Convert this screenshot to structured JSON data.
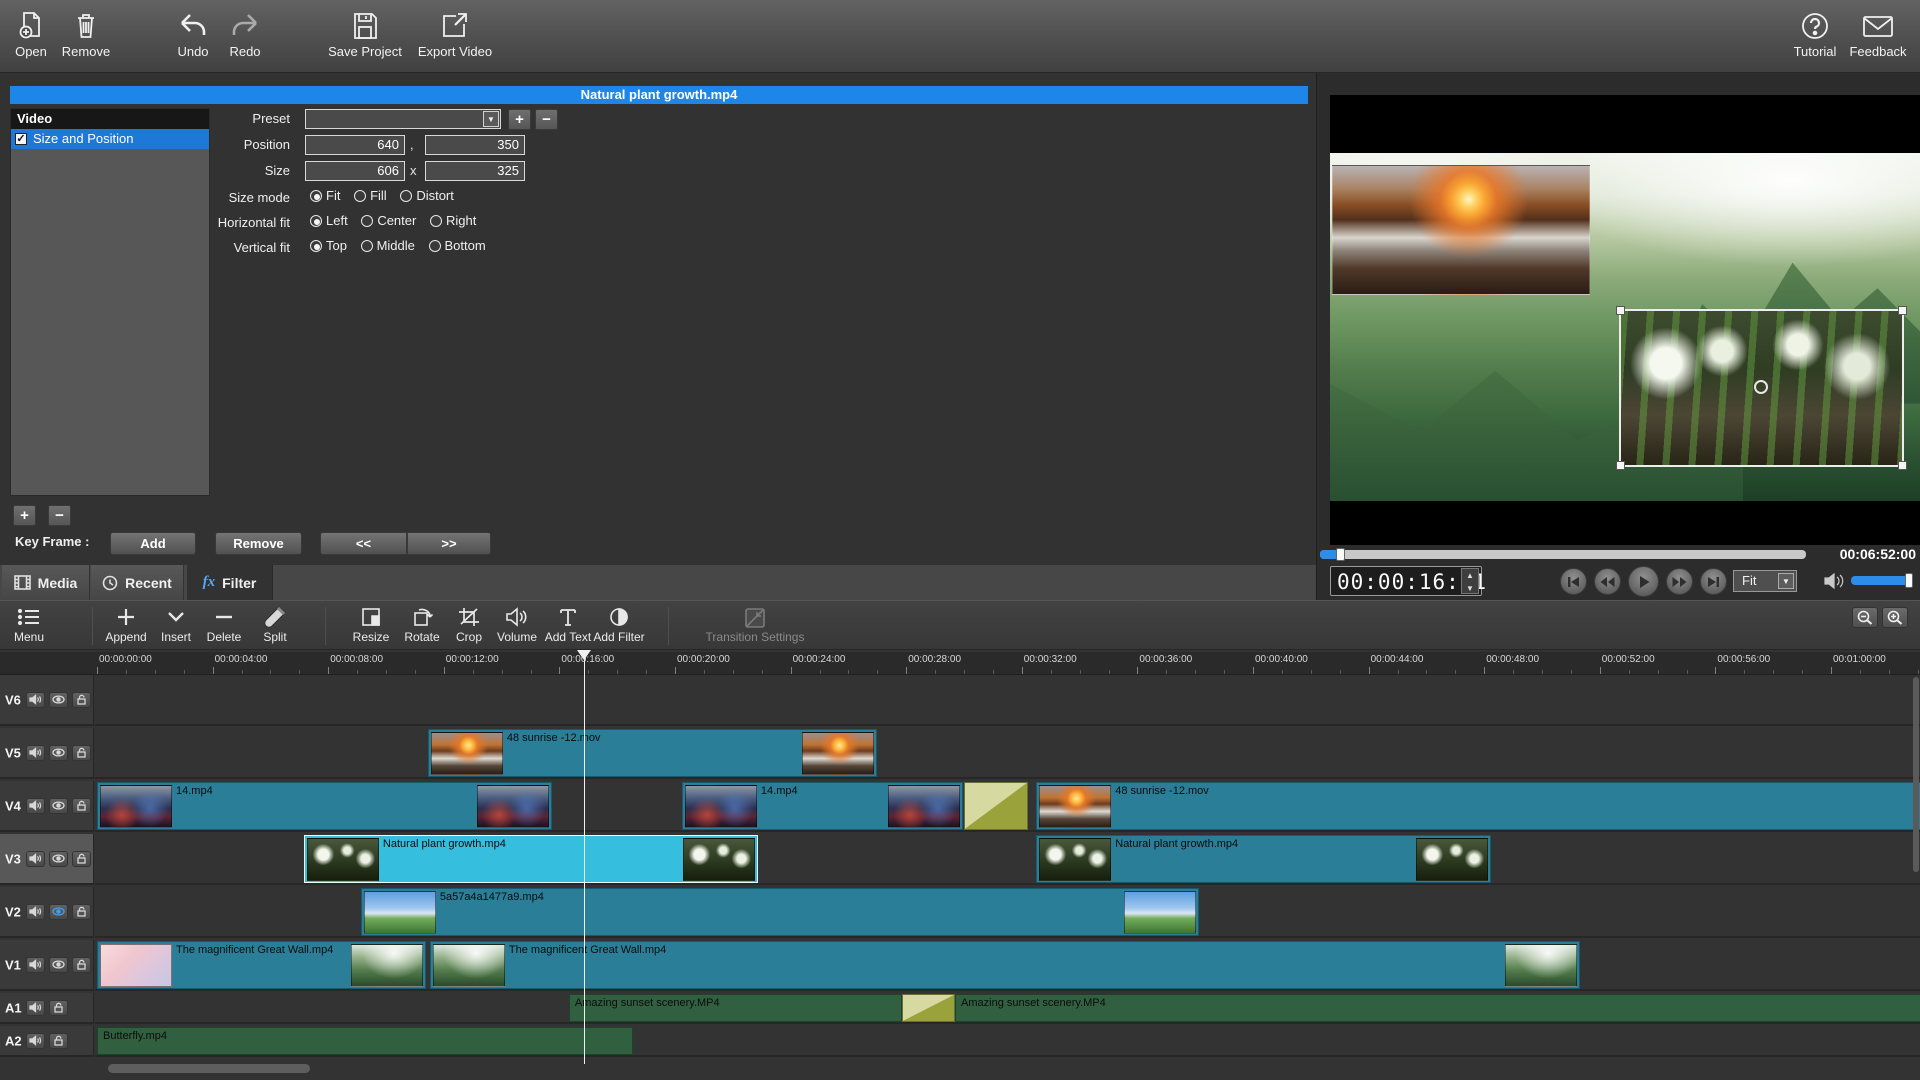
{
  "toolbar": {
    "items": [
      {
        "id": "open",
        "label": "Open"
      },
      {
        "id": "remove",
        "label": "Remove"
      },
      {
        "id": "undo",
        "label": "Undo"
      },
      {
        "id": "redo",
        "label": "Redo"
      },
      {
        "id": "save",
        "label": "Save Project"
      },
      {
        "id": "export",
        "label": "Export Video"
      }
    ],
    "right_items": [
      {
        "id": "tutorial",
        "label": "Tutorial"
      },
      {
        "id": "feedback",
        "label": "Feedback"
      }
    ]
  },
  "properties": {
    "title": "Natural plant growth.mp4",
    "filter_list": {
      "header": "Video",
      "items": [
        {
          "label": "Size and Position",
          "checked": true
        }
      ]
    },
    "preset_label": "Preset",
    "position_label": "Position",
    "position_x": "640",
    "comma": ",",
    "position_y": "350",
    "size_label": "Size",
    "size_w": "606",
    "times": "x",
    "size_h": "325",
    "size_mode": {
      "label": "Size mode",
      "options": [
        "Fit",
        "Fill",
        "Distort"
      ],
      "selected": "Fit"
    },
    "horizontal_fit": {
      "label": "Horizontal fit",
      "options": [
        "Left",
        "Center",
        "Right"
      ],
      "selected": "Left"
    },
    "vertical_fit": {
      "label": "Vertical fit",
      "options": [
        "Top",
        "Middle",
        "Bottom"
      ],
      "selected": "Top"
    },
    "add_filter": "+",
    "remove_filter": "−",
    "keyframe": {
      "label": "Key Frame :",
      "add": "Add",
      "remove": "Remove",
      "prev": "<<",
      "next": ">>"
    }
  },
  "tabs": [
    {
      "label": "Media",
      "active": false
    },
    {
      "label": "Recent",
      "active": false
    },
    {
      "label": "Filter",
      "active": true
    }
  ],
  "preview": {
    "timecode": "00:00:16:21",
    "total_time": "00:06:52:00",
    "fit_mode": "Fit",
    "progress_percent": 4.1,
    "volume_percent": 100
  },
  "timeline": {
    "toolbar_items": [
      {
        "id": "menu",
        "label": "Menu"
      },
      {
        "id": "append",
        "label": "Append"
      },
      {
        "id": "insert",
        "label": "Insert"
      },
      {
        "id": "delete",
        "label": "Delete"
      },
      {
        "id": "split",
        "label": "Split"
      },
      {
        "id": "resize",
        "label": "Resize"
      },
      {
        "id": "rotate",
        "label": "Rotate"
      },
      {
        "id": "crop",
        "label": "Crop"
      },
      {
        "id": "volume",
        "label": "Volume"
      },
      {
        "id": "addtext",
        "label": "Add Text"
      },
      {
        "id": "addfilter",
        "label": "Add Filter"
      },
      {
        "id": "transition",
        "label": "Transition Settings",
        "disabled": true
      }
    ],
    "ruler_labels": [
      "00:00:00:00",
      "00:00:04:00",
      "00:00:08:00",
      "00:00:12:00",
      "00:00:16:00",
      "00:00:20:00",
      "00:00:24:00",
      "00:00:28:00",
      "00:00:32:00",
      "00:00:36:00",
      "00:00:40:00",
      "00:00:44:00",
      "00:00:48:00",
      "00:00:52:00",
      "00:00:56:00",
      "00:01:00:00"
    ],
    "playhead_seconds": 16.84,
    "tracks": [
      {
        "name": "V6",
        "type": "video",
        "clips": []
      },
      {
        "name": "V5",
        "type": "video",
        "clips": [
          {
            "name": "48 sunrise -12.mov",
            "start": 11.45,
            "end": 27.0,
            "thumb_start": "sunset",
            "thumb_end": "sunset"
          }
        ]
      },
      {
        "name": "V4",
        "type": "video",
        "clips": [
          {
            "name": "14.mp4",
            "start": 0,
            "end": 15.74,
            "thumb_start": "city",
            "thumb_end": "city"
          },
          {
            "name": "14.mp4",
            "start": 20.24,
            "end": 29.97,
            "thumb_start": "city",
            "thumb_end": "city"
          },
          {
            "transition": true,
            "start": 30.0,
            "end": 32.2
          },
          {
            "name": "48 sunrise -12.mov",
            "start": 32.5,
            "end": 64.0,
            "thumb_start": "sunset"
          }
        ]
      },
      {
        "name": "V3",
        "type": "video",
        "header_highlight": true,
        "clips": [
          {
            "name": "Natural plant growth.mp4",
            "start": 7.16,
            "end": 22.87,
            "thumb_start": "flowers",
            "thumb_end": "flowers",
            "selected": true
          },
          {
            "name": "Natural plant growth.mp4",
            "start": 32.5,
            "end": 48.24,
            "thumb_start": "flowers",
            "thumb_end": "flowers"
          }
        ]
      },
      {
        "name": "V2",
        "type": "video",
        "eye_blue": true,
        "clips": [
          {
            "name": "5a57a4a1477a9.mp4",
            "start": 9.13,
            "end": 38.13,
            "thumb_start": "meadow",
            "thumb_end": "meadow"
          }
        ]
      },
      {
        "name": "V1",
        "type": "video",
        "clips": [
          {
            "name": "The magnificent Great Wall.mp4",
            "start": 0,
            "end": 11.38,
            "thumb_start": "pink",
            "thumb_end": "wall"
          },
          {
            "name": "The magnificent Great Wall.mp4",
            "start": 11.52,
            "end": 51.3,
            "thumb_start": "wall",
            "thumb_end": "wall"
          }
        ]
      },
      {
        "name": "A1",
        "type": "audio",
        "clips": [
          {
            "name": "Amazing sunset scenery.MP4",
            "start": 16.33,
            "end": 27.85
          },
          {
            "transition": true,
            "start": 27.85,
            "end": 29.69
          },
          {
            "name": "Amazing sunset scenery.MP4",
            "start": 29.69,
            "end": 64.0
          }
        ]
      },
      {
        "name": "A2",
        "type": "audio",
        "clips": [
          {
            "name": "Butterfly.mp4",
            "start": 0,
            "end": 18.55
          }
        ]
      }
    ]
  }
}
